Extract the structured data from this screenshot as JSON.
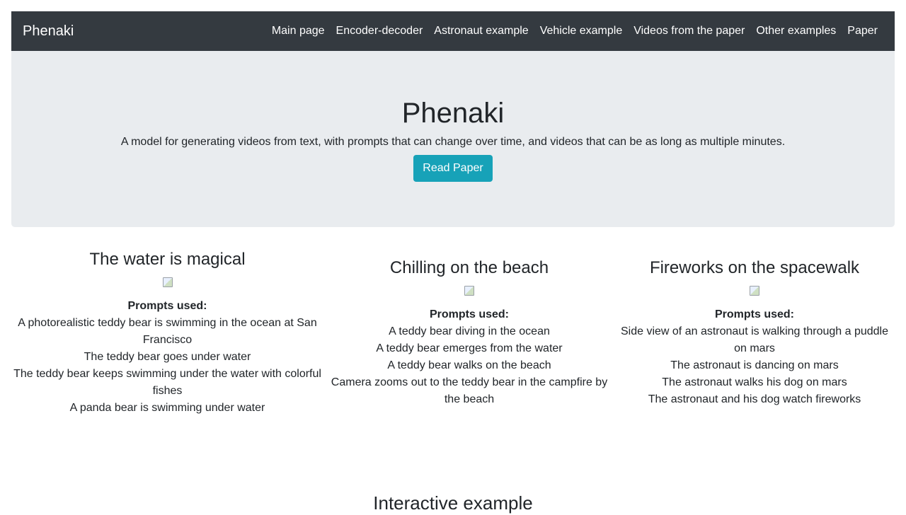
{
  "navbar": {
    "brand": "Phenaki",
    "links": [
      "Main page",
      "Encoder-decoder",
      "Astronaut example",
      "Vehicle example",
      "Videos from the paper",
      "Other examples",
      "Paper"
    ]
  },
  "hero": {
    "title": "Phenaki",
    "subtitle": "A model for generating videos from text, with prompts that can change over time, and videos that can be as long as multiple minutes.",
    "button": "Read Paper",
    "button_color": "#17a2b8"
  },
  "examples": [
    {
      "title": "The water is magical",
      "prompts_label": "Prompts used:",
      "prompts": [
        "A photorealistic teddy bear is swimming in the ocean at San Francisco",
        "The teddy bear goes under water",
        "The teddy bear keeps swimming under the water with colorful fishes",
        "A panda bear is swimming under water"
      ]
    },
    {
      "title": "Chilling on the beach",
      "prompts_label": "Prompts used:",
      "prompts": [
        "A teddy bear diving in the ocean",
        "A teddy bear emerges from the water",
        "A teddy bear walks on the beach",
        "Camera zooms out to the teddy bear in the campfire by the beach"
      ]
    },
    {
      "title": "Fireworks on the spacewalk",
      "prompts_label": "Prompts used:",
      "prompts": [
        "Side view of an astronaut is walking through a puddle on mars",
        "The astronaut is dancing on mars",
        "The astronaut walks his dog on mars",
        "The astronaut and his dog watch fireworks"
      ]
    }
  ],
  "interactive": {
    "title": "Interactive example"
  },
  "colors": {
    "navbar_bg": "#343a40",
    "hero_bg": "#e9ecef"
  }
}
